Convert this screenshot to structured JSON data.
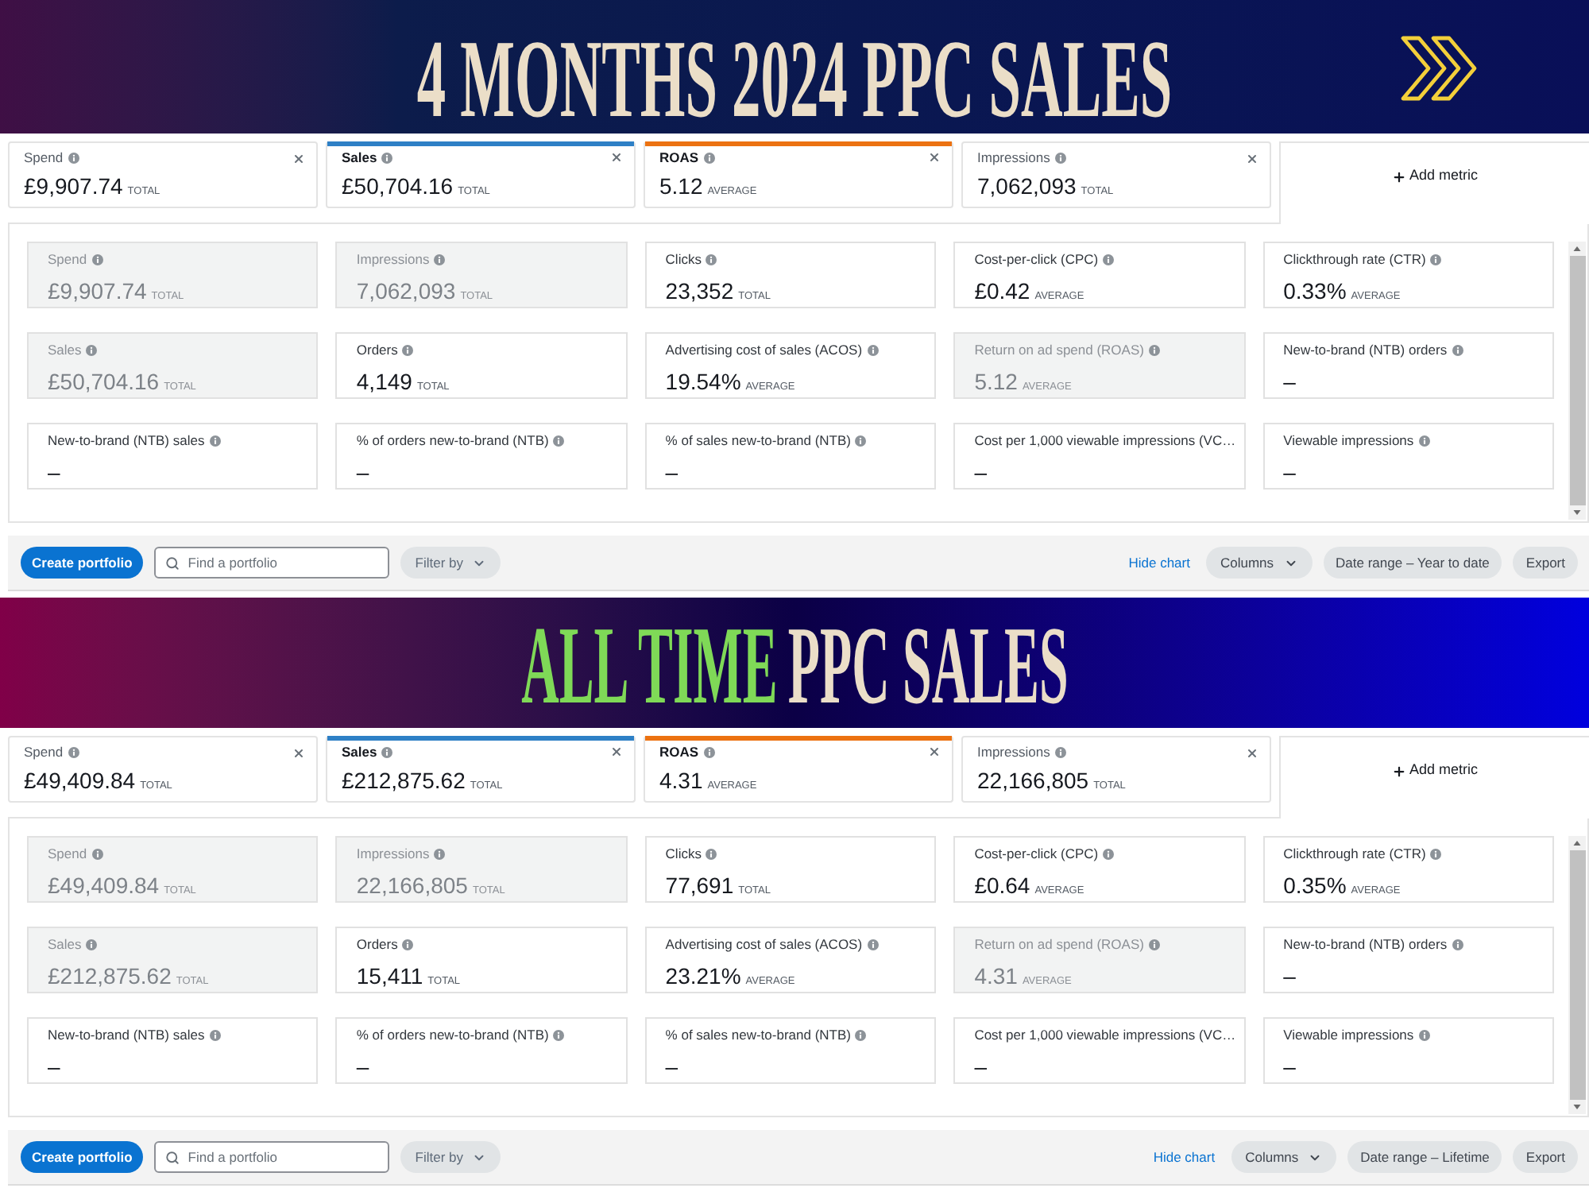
{
  "sections": [
    {
      "banner": {
        "title_parts": [
          {
            "text": "4 MONTHS 2024 PPC SALES",
            "highlight": false
          }
        ],
        "corner_icon": true
      },
      "metric_tabs": [
        {
          "label": "Spend",
          "value": "£9,907.74",
          "unit": "TOTAL",
          "selected": false
        },
        {
          "label": "Sales",
          "value": "£50,704.16",
          "unit": "TOTAL",
          "selected": true,
          "color": "#2e80c6"
        },
        {
          "label": "ROAS",
          "value": "5.12",
          "unit": "AVERAGE",
          "selected": true,
          "color": "#ec7211"
        },
        {
          "label": "Impressions",
          "value": "7,062,093",
          "unit": "TOTAL",
          "selected": false
        }
      ],
      "add_metric": "Add metric",
      "metric_cards": [
        {
          "label": "Spend",
          "value": "£9,907.74",
          "unit": "TOTAL",
          "disabled": true,
          "info": true
        },
        {
          "label": "Impressions",
          "value": "7,062,093",
          "unit": "TOTAL",
          "disabled": true,
          "info": true
        },
        {
          "label": "Clicks",
          "value": "23,352",
          "unit": "TOTAL",
          "disabled": false,
          "info": true
        },
        {
          "label": "Cost-per-click (CPC)",
          "value": "£0.42",
          "unit": "AVERAGE",
          "disabled": false,
          "info": true
        },
        {
          "label": "Clickthrough rate (CTR)",
          "value": "0.33%",
          "unit": "AVERAGE",
          "disabled": false,
          "info": true
        },
        {
          "label": "Sales",
          "value": "£50,704.16",
          "unit": "TOTAL",
          "disabled": true,
          "info": true
        },
        {
          "label": "Orders",
          "value": "4,149",
          "unit": "TOTAL",
          "disabled": false,
          "info": true
        },
        {
          "label": "Advertising cost of sales (ACOS)",
          "value": "19.54%",
          "unit": "AVERAGE",
          "disabled": false,
          "info": true
        },
        {
          "label": "Return on ad spend (ROAS)",
          "value": "5.12",
          "unit": "AVERAGE",
          "disabled": true,
          "info": true
        },
        {
          "label": "New-to-brand (NTB) orders",
          "value": "–",
          "disabled": false,
          "info": true
        },
        {
          "label": "New-to-brand (NTB) sales",
          "value": "–",
          "disabled": false,
          "info": true
        },
        {
          "label": "% of orders new-to-brand (NTB)",
          "value": "–",
          "disabled": false,
          "info": true
        },
        {
          "label": "% of sales new-to-brand (NTB)",
          "value": "–",
          "disabled": false,
          "info": true
        },
        {
          "label": "Cost per 1,000 viewable impressions (VC…",
          "value": "–",
          "disabled": false,
          "info": false
        },
        {
          "label": "Viewable impressions",
          "value": "–",
          "disabled": false,
          "info": true
        }
      ],
      "toolbar": {
        "create_button": "Create portfolio",
        "search": {
          "placeholder": "Find a portfolio"
        },
        "filter": "Filter by",
        "hide_chart": "Hide chart",
        "columns": "Columns",
        "date_range": "Date range – Year to date",
        "export": "Export"
      }
    },
    {
      "banner": {
        "title_parts": [
          {
            "text": "ALL TIME",
            "highlight": true
          },
          {
            "text": "PPC SALES",
            "highlight": false
          }
        ],
        "corner_icon": false
      },
      "metric_tabs": [
        {
          "label": "Spend",
          "value": "£49,409.84",
          "unit": "TOTAL",
          "selected": false
        },
        {
          "label": "Sales",
          "value": "£212,875.62",
          "unit": "TOTAL",
          "selected": true,
          "color": "#2e80c6"
        },
        {
          "label": "ROAS",
          "value": "4.31",
          "unit": "AVERAGE",
          "selected": true,
          "color": "#ec7211"
        },
        {
          "label": "Impressions",
          "value": "22,166,805",
          "unit": "TOTAL",
          "selected": false
        }
      ],
      "add_metric": "Add metric",
      "metric_cards": [
        {
          "label": "Spend",
          "value": "£49,409.84",
          "unit": "TOTAL",
          "disabled": true,
          "info": true
        },
        {
          "label": "Impressions",
          "value": "22,166,805",
          "unit": "TOTAL",
          "disabled": true,
          "info": true
        },
        {
          "label": "Clicks",
          "value": "77,691",
          "unit": "TOTAL",
          "disabled": false,
          "info": true
        },
        {
          "label": "Cost-per-click (CPC)",
          "value": "£0.64",
          "unit": "AVERAGE",
          "disabled": false,
          "info": true
        },
        {
          "label": "Clickthrough rate (CTR)",
          "value": "0.35%",
          "unit": "AVERAGE",
          "disabled": false,
          "info": true
        },
        {
          "label": "Sales",
          "value": "£212,875.62",
          "unit": "TOTAL",
          "disabled": true,
          "info": true
        },
        {
          "label": "Orders",
          "value": "15,411",
          "unit": "TOTAL",
          "disabled": false,
          "info": true
        },
        {
          "label": "Advertising cost of sales (ACOS)",
          "value": "23.21%",
          "unit": "AVERAGE",
          "disabled": false,
          "info": true
        },
        {
          "label": "Return on ad spend (ROAS)",
          "value": "4.31",
          "unit": "AVERAGE",
          "disabled": true,
          "info": true
        },
        {
          "label": "New-to-brand (NTB) orders",
          "value": "–",
          "disabled": false,
          "info": true
        },
        {
          "label": "New-to-brand (NTB) sales",
          "value": "–",
          "disabled": false,
          "info": true
        },
        {
          "label": "% of orders new-to-brand (NTB)",
          "value": "–",
          "disabled": false,
          "info": true
        },
        {
          "label": "% of sales new-to-brand (NTB)",
          "value": "–",
          "disabled": false,
          "info": true
        },
        {
          "label": "Cost per 1,000 viewable impressions (VC…",
          "value": "–",
          "disabled": false,
          "info": false
        },
        {
          "label": "Viewable impressions",
          "value": "–",
          "disabled": false,
          "info": true
        }
      ],
      "toolbar": {
        "create_button": "Create portfolio",
        "search": {
          "placeholder": "Find a portfolio"
        },
        "filter": "Filter by",
        "hide_chart": "Hide chart",
        "columns": "Columns",
        "date_range": "Date range – Lifetime",
        "export": "Export"
      }
    }
  ]
}
